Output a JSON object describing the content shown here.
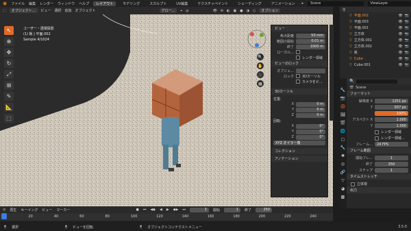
{
  "menubar": {
    "items": [
      "ファイル",
      "編集",
      "レンダー",
      "ウィンドウ",
      "ヘルプ"
    ],
    "workspaces": [
      "レイアウト",
      "モデリング",
      "スカルプト",
      "UV編集",
      "テクスチャペイント",
      "シェーディング",
      "アニメーション"
    ],
    "active_workspace": "レイアウト",
    "scene": "Scene",
    "view_layer": "ViewLayer"
  },
  "header3d": {
    "mode": "オブジェクト...",
    "menus": [
      "ビュー",
      "選択",
      "追加",
      "オブジェクト"
    ],
    "transform": "グロー...",
    "options": "オプション"
  },
  "overlay": {
    "line1": "ユーザー・透視投影",
    "line2": "(1) 板 | 平面.002",
    "line3": "Sample 4/1024"
  },
  "npanel": {
    "view_title": "ビュー",
    "focal_label": "焦点距離",
    "focal_value": "50 mm",
    "clip_start_label": "範囲の開始",
    "clip_start_value": "0.01 m",
    "clip_end_label": "終了",
    "clip_end_value": "1000 m",
    "local_label": "ローカル...",
    "render_region": "レンダー領域",
    "view_lock_title": "ビューのロック",
    "obj_label": "オブジェ...",
    "lock_label": "ロック",
    "lock_3d": "3Dカーソル",
    "lock_camera": "カメラをビ...",
    "cursor_title": "3Dカーソル",
    "location_label": "位置:",
    "x_label": "X",
    "y_label": "Y",
    "z_label": "Z",
    "loc_x": "0 m",
    "loc_y": "0 m",
    "loc_z": "0 m",
    "rotation_label": "回転:",
    "rot_x": "0°",
    "rot_y": "0°",
    "rot_z": "0°",
    "rot_mode": "XYZ オイラー角",
    "collection": "コレクション",
    "annotation": "アノテーション"
  },
  "outliner": {
    "items": [
      {
        "name": "平面.002",
        "highlight": true
      },
      {
        "name": "平面.003",
        "highlight": false
      },
      {
        "name": "平面.001",
        "highlight": false
      },
      {
        "name": "立方体",
        "highlight": false
      },
      {
        "name": "立方体.001",
        "highlight": false
      },
      {
        "name": "立方体.002",
        "highlight": false
      },
      {
        "name": "板",
        "highlight": false
      },
      {
        "name": "Cube",
        "highlight": true
      },
      {
        "name": "Cube.001",
        "highlight": false
      }
    ]
  },
  "properties": {
    "search_placeholder": "",
    "scene_name": "Scene",
    "format_title": "フォーマット",
    "res_x_label": "解像度 X",
    "res_x": "1251 px",
    "res_y_label": "Y",
    "res_y": "937 px",
    "res_pct": "100%",
    "aspect_x_label": "アスペクト X",
    "aspect_x": "1.000",
    "aspect_y_label": "Y",
    "aspect_y": "1.000",
    "render_region": "レンダー領域",
    "crop_label": "レンダー領域...",
    "fps_label": "フレーム...",
    "fps": "24 FPS",
    "frame_range_title": "フレーム範囲",
    "start_label": "開始フレ...",
    "start": "1",
    "end_label": "終了",
    "end": "250",
    "step_label": "ステップ",
    "step": "1",
    "time_stretch": "タイムストレッチ",
    "stereoscopy": "立体視",
    "output": "出力"
  },
  "timeline": {
    "playback": "再生",
    "keying": "キーイング",
    "view": "ビュー",
    "marker": "マーカー",
    "current_frame": "1",
    "start_label": "開始",
    "start": "1",
    "end_label": "終了",
    "end": "250",
    "ticks": [
      "1",
      "20",
      "40",
      "60",
      "80",
      "100",
      "120",
      "140",
      "160",
      "180",
      "200",
      "220",
      "240"
    ]
  },
  "statusbar": {
    "select": "選択",
    "rotate_view": "ビューを回転",
    "context_menu": "オブジェクトコンテクストメニュー",
    "version": "3.5.0"
  },
  "colors": {
    "accent": "#e06a29",
    "active_highlight": "#f2913d",
    "viewport_floor": "#c9c1b4",
    "panel_bg": "#2a2a2a"
  }
}
